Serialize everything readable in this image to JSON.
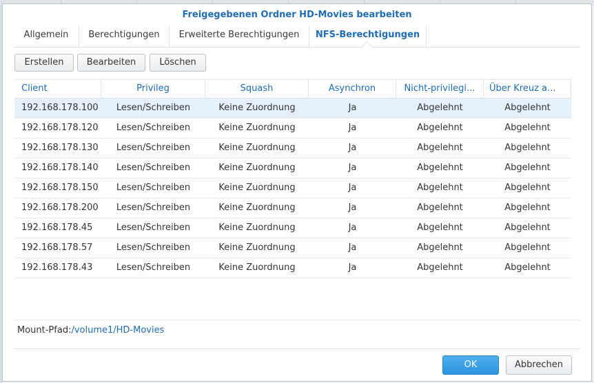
{
  "dialog": {
    "title": "Freigegebenen Ordner HD-Movies bearbeiten"
  },
  "tabs": [
    {
      "label": "Allgemein"
    },
    {
      "label": "Berechtigungen"
    },
    {
      "label": "Erweiterte Berechtigungen"
    },
    {
      "label": "NFS-Berechtigungen",
      "active": true
    }
  ],
  "toolbar": {
    "create_label": "Erstellen",
    "edit_label": "Bearbeiten",
    "delete_label": "Löschen"
  },
  "table": {
    "columns": [
      "Client",
      "Privileg",
      "Squash",
      "Asynchron",
      "Nicht-privilegi...",
      "Über Kreuz a..."
    ],
    "rows": [
      [
        "192.168.178.100",
        "Lesen/Schreiben",
        "Keine Zuordnung",
        "Ja",
        "Abgelehnt",
        "Abgelehnt"
      ],
      [
        "192.168.178.120",
        "Lesen/Schreiben",
        "Keine Zuordnung",
        "Ja",
        "Abgelehnt",
        "Abgelehnt"
      ],
      [
        "192.168.178.130",
        "Lesen/Schreiben",
        "Keine Zuordnung",
        "Ja",
        "Abgelehnt",
        "Abgelehnt"
      ],
      [
        "192.168.178.140",
        "Lesen/Schreiben",
        "Keine Zuordnung",
        "Ja",
        "Abgelehnt",
        "Abgelehnt"
      ],
      [
        "192.168.178.150",
        "Lesen/Schreiben",
        "Keine Zuordnung",
        "Ja",
        "Abgelehnt",
        "Abgelehnt"
      ],
      [
        "192.168.178.200",
        "Lesen/Schreiben",
        "Keine Zuordnung",
        "Ja",
        "Abgelehnt",
        "Abgelehnt"
      ],
      [
        "192.168.178.45",
        "Lesen/Schreiben",
        "Keine Zuordnung",
        "Ja",
        "Abgelehnt",
        "Abgelehnt"
      ],
      [
        "192.168.178.57",
        "Lesen/Schreiben",
        "Keine Zuordnung",
        "Ja",
        "Abgelehnt",
        "Abgelehnt"
      ],
      [
        "192.168.178.43",
        "Lesen/Schreiben",
        "Keine Zuordnung",
        "Ja",
        "Abgelehnt",
        "Abgelehnt"
      ]
    ],
    "selected_row": 0
  },
  "mount": {
    "label": "Mount-Pfad:",
    "path": "/volume1/HD-Movies"
  },
  "footer": {
    "ok_label": "OK",
    "cancel_label": "Abbrechen"
  },
  "colors": {
    "accent": "#1e6db5",
    "ok_button": "#2d93df",
    "selected_row": "#e5f0fa"
  }
}
